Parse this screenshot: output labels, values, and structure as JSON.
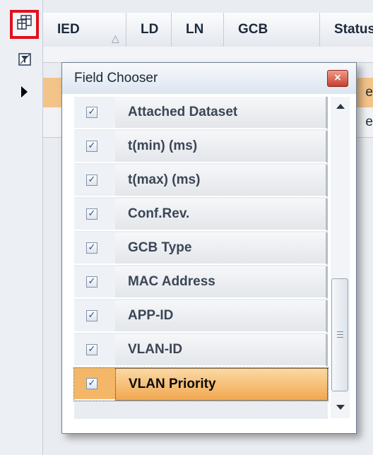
{
  "grid": {
    "columns": [
      {
        "label": "IED"
      },
      {
        "label": "LD"
      },
      {
        "label": "LN"
      },
      {
        "label": "GCB"
      },
      {
        "label": "Status"
      }
    ],
    "sort_indicator": "△",
    "row_trailing_text": [
      "e",
      "e"
    ]
  },
  "dialog": {
    "title": "Field Chooser",
    "close_glyph": "×",
    "check_glyph": "✓",
    "fields": [
      {
        "label": "Attached Dataset",
        "checked": true,
        "selected": false
      },
      {
        "label": "t(min) (ms)",
        "checked": true,
        "selected": false
      },
      {
        "label": "t(max) (ms)",
        "checked": true,
        "selected": false
      },
      {
        "label": "Conf.Rev.",
        "checked": true,
        "selected": false
      },
      {
        "label": "GCB Type",
        "checked": true,
        "selected": false
      },
      {
        "label": "MAC Address",
        "checked": true,
        "selected": false
      },
      {
        "label": "APP-ID",
        "checked": true,
        "selected": false
      },
      {
        "label": "VLAN-ID",
        "checked": true,
        "selected": false
      },
      {
        "label": "VLAN Priority",
        "checked": true,
        "selected": true
      }
    ]
  },
  "icons": {
    "column_chooser": "column-chooser-icon",
    "filter": "filter-icon",
    "current_row": "current-row-arrow-icon"
  },
  "colors": {
    "highlight_border": "#e0101b",
    "selected_row": "#f2a84f",
    "grid_selected_row": "#f3c489"
  }
}
